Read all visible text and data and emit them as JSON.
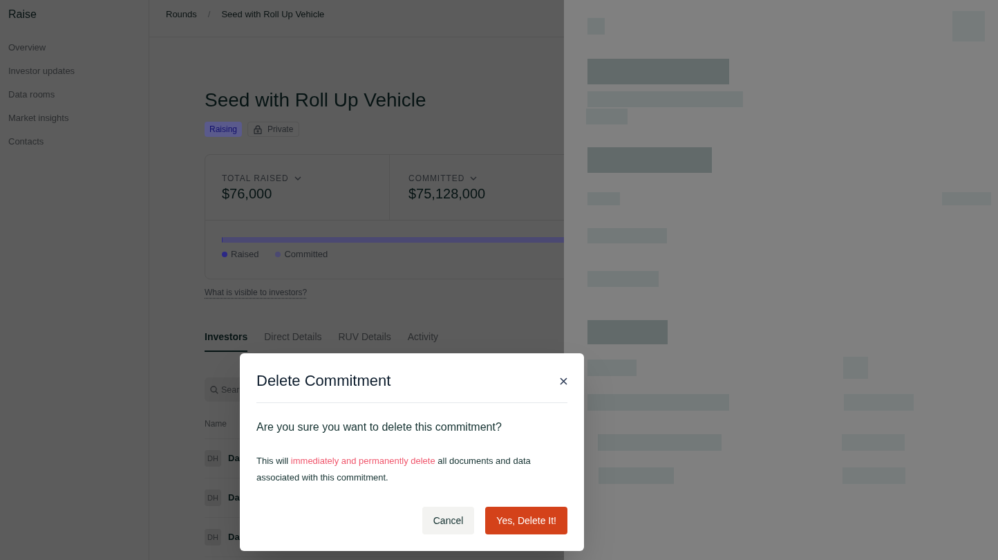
{
  "sidebar": {
    "brand": "Raise",
    "items": [
      {
        "label": "Overview"
      },
      {
        "label": "Investor updates"
      },
      {
        "label": "Data rooms"
      },
      {
        "label": "Market insights"
      },
      {
        "label": "Contacts"
      }
    ]
  },
  "breadcrumb": {
    "items": [
      {
        "label": "Rounds"
      },
      {
        "label": "Seed with Roll Up Vehicle"
      }
    ],
    "separator": "/"
  },
  "round": {
    "title": "Seed with Roll Up Vehicle",
    "badges": [
      {
        "kind": "status",
        "label": "Raising"
      },
      {
        "kind": "visibility",
        "label": "Private"
      }
    ]
  },
  "stats": [
    {
      "label": "TOTAL RAISED",
      "value": "$76,000"
    },
    {
      "label": "COMMITTED",
      "value": "$75,128,000"
    }
  ],
  "progress": {
    "series": [
      {
        "label": "Raised",
        "color": "#2c2885",
        "level": 0.003
      },
      {
        "label": "Committed",
        "color": "#4b4972",
        "level": 1
      }
    ]
  },
  "visibility_link": "What is visible to investors?",
  "tabs": [
    {
      "label": "Investors",
      "selected": true
    },
    {
      "label": "Direct Details",
      "selected": false
    },
    {
      "label": "RUV Details",
      "selected": false
    },
    {
      "label": "Activity",
      "selected": false
    }
  ],
  "search": {
    "placeholder": "Sear"
  },
  "table": {
    "columns": [
      "Name"
    ],
    "rows": [
      {
        "initials": "DH",
        "name": "Da"
      },
      {
        "initials": "DH",
        "name": "Da"
      },
      {
        "initials": "DH",
        "name": "Da"
      }
    ]
  },
  "dialog": {
    "title": "Delete Commitment",
    "question": "Are you sure you want to delete this commitment?",
    "message": [
      {
        "kind": "plain",
        "text": "This will "
      },
      {
        "kind": "warning",
        "text": "immediately and permanently delete"
      },
      {
        "kind": "plain",
        "text": " all documents and data associated with this commitment."
      }
    ],
    "buttons": [
      {
        "kind": "secondary",
        "label": "Cancel"
      },
      {
        "kind": "danger",
        "label": "Yes, Delete It!"
      }
    ]
  }
}
